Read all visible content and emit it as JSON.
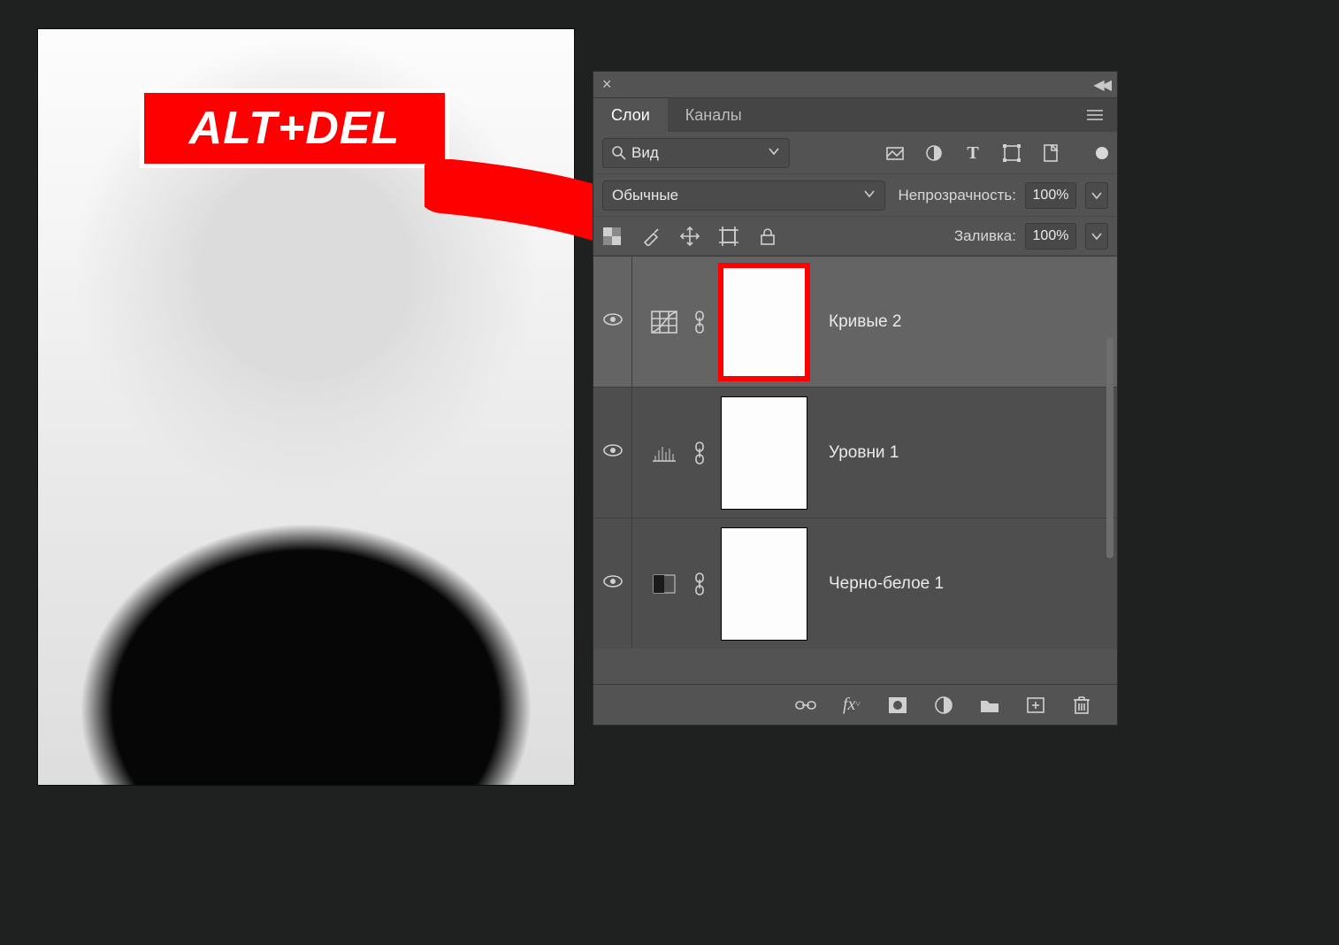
{
  "overlay": {
    "badge_text": "ALT+DEL"
  },
  "panel": {
    "tabs": {
      "layers": "Слои",
      "channels": "Каналы"
    },
    "filter_dropdown": "Вид",
    "blend_mode": "Обычные",
    "opacity": {
      "label": "Непрозрачность:",
      "value": "100%"
    },
    "fill": {
      "label": "Заливка:",
      "value": "100%"
    },
    "lock_label": "",
    "layers": [
      {
        "name": "Кривые 2",
        "adjustment": "curves",
        "selected": true,
        "highlight_mask": true
      },
      {
        "name": "Уровни 1",
        "adjustment": "levels",
        "selected": false,
        "highlight_mask": false
      },
      {
        "name": "Черно-белое 1",
        "adjustment": "bw",
        "selected": false,
        "highlight_mask": false
      }
    ]
  }
}
